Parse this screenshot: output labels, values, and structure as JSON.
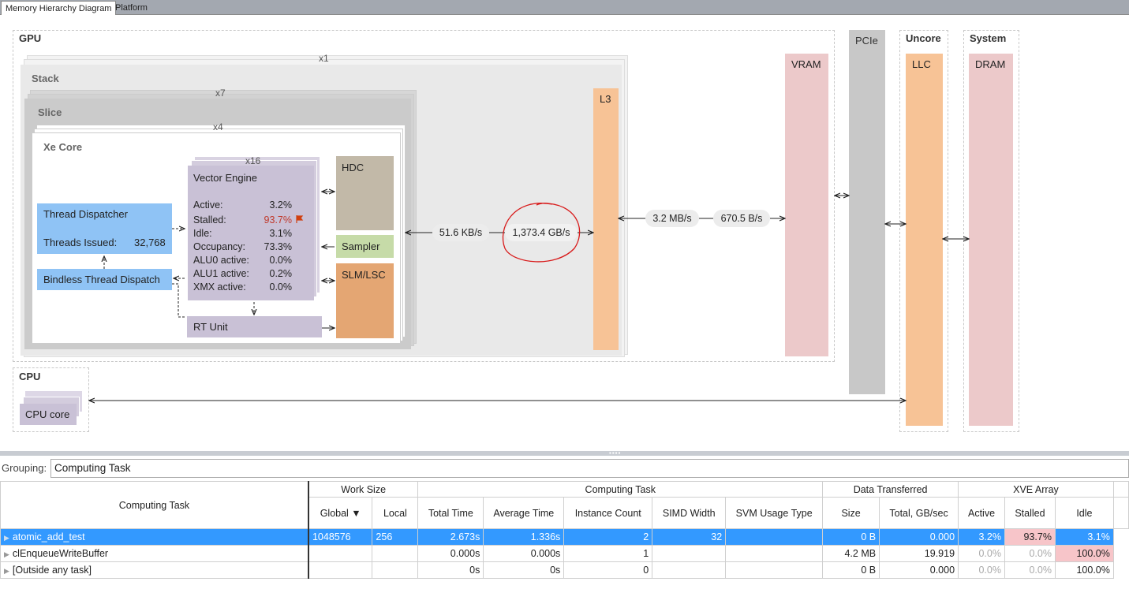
{
  "tabs": [
    "Memory Hierarchy Diagram",
    "Platform"
  ],
  "gpu": {
    "label": "GPU",
    "stack": {
      "label": "Stack",
      "mult": "x1"
    },
    "slice": {
      "label": "Slice",
      "mult": "x7"
    },
    "xecore": {
      "label": "Xe Core",
      "mult": "x4"
    },
    "ve": {
      "title": "Vector Engine",
      "mult": "x16",
      "metrics": [
        {
          "label": "Active:",
          "value": "3.2%"
        },
        {
          "label": "Stalled:",
          "value": "93.7%"
        },
        {
          "label": "Idle:",
          "value": "3.1%"
        },
        {
          "label": "Occupancy:",
          "value": "73.3%"
        },
        {
          "label": "ALU0 active:",
          "value": "0.0%"
        },
        {
          "label": "ALU1 active:",
          "value": "0.2%"
        },
        {
          "label": "XMX active:",
          "value": "0.0%"
        }
      ]
    },
    "thread_dispatcher": {
      "title": "Thread Dispatcher",
      "issued_label": "Threads Issued:",
      "issued_value": "32,768"
    },
    "bindless": "Bindless Thread Dispatch",
    "rt_unit": "RT Unit",
    "hdc": "HDC",
    "sampler": "Sampler",
    "slm": "SLM/LSC",
    "l3": "L3",
    "vram": "VRAM",
    "bw_core_l3": "51.6 KB/s",
    "bw_l3": "1,373.4 GB/s",
    "bw_l3_vram_1": "3.2 MB/s",
    "bw_l3_vram_2": "670.5 B/s"
  },
  "pcie": "PCIe",
  "uncore": {
    "label": "Uncore",
    "llc": "LLC"
  },
  "system": {
    "label": "System",
    "dram": "DRAM"
  },
  "cpu": {
    "label": "CPU",
    "core": "CPU core"
  },
  "colors": {
    "blue": "#8fc3f5",
    "purple": "#c9c1d6",
    "tan": "#c2b9a8",
    "green": "#c6dba8",
    "orange": "#e4a673",
    "peach": "#f7c396",
    "pink": "#ecc9ca",
    "flag": "#d04010"
  },
  "grouping": {
    "label": "Grouping:",
    "value": "Computing Task"
  },
  "table": {
    "row_header": "Computing Task",
    "groups": [
      "Work Size",
      "Computing Task",
      "Data Transferred",
      "XVE Array"
    ],
    "columns": [
      "Global ▼",
      "Local",
      "Total Time",
      "Average Time",
      "Instance Count",
      "SIMD Width",
      "SVM Usage Type",
      "Size",
      "Total, GB/sec",
      "Active",
      "Stalled",
      "Idle"
    ],
    "rows": [
      {
        "name": "atomic_add_test",
        "cells": [
          "1048576",
          "256",
          "2.673s",
          "1.336s",
          "2",
          "32",
          "",
          "0 B",
          "0.000",
          "3.2%",
          "93.7%",
          "3.1%"
        ]
      },
      {
        "name": "clEnqueueWriteBuffer",
        "cells": [
          "",
          "",
          "0.000s",
          "0.000s",
          "1",
          "",
          "",
          "4.2 MB",
          "19.919",
          "0.0%",
          "0.0%",
          "100.0%"
        ]
      },
      {
        "name": "[Outside any task]",
        "cells": [
          "",
          "",
          "0s",
          "0s",
          "0",
          "",
          "",
          "0 B",
          "0.000",
          "0.0%",
          "0.0%",
          "100.0%"
        ]
      }
    ]
  }
}
